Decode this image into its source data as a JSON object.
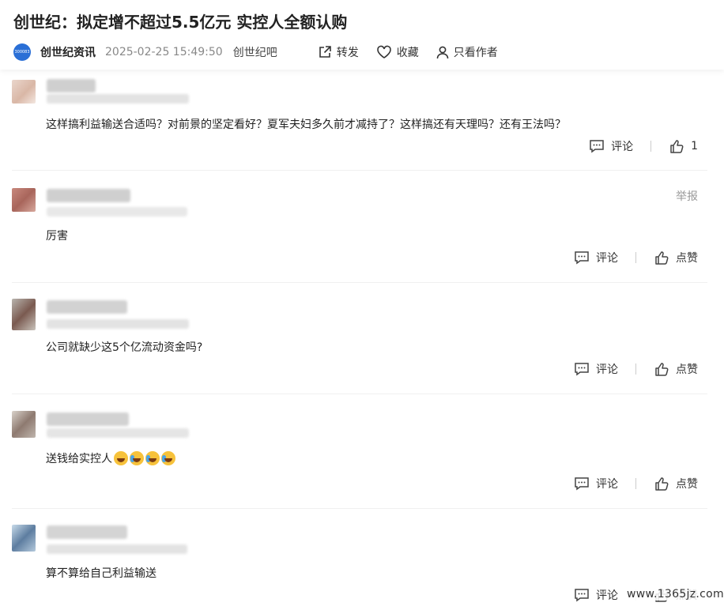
{
  "article": {
    "title": "创世纪：拟定增不超过5.5亿元 实控人全额认购",
    "logo_text": "300083",
    "source": "创世纪资讯",
    "datetime": "2025-02-25 15:49:50",
    "bar": "创世纪吧",
    "actions": {
      "share": "转发",
      "favorite": "收藏",
      "author_only": "只看作者"
    }
  },
  "comments": [
    {
      "text": "这样搞利益输送合适吗？对前景的坚定看好？夏军夫妇多久前才减持了？这样搞还有天理吗？还有王法吗？",
      "reply": "评论",
      "like": "1",
      "report": ""
    },
    {
      "text": "厉害",
      "reply": "评论",
      "like": "点赞",
      "report": "举报"
    },
    {
      "text": "公司就缺少这5个亿流动资金吗?",
      "reply": "评论",
      "like": "点赞",
      "report": ""
    },
    {
      "text": "送钱给实控人",
      "reply": "评论",
      "like": "点赞",
      "report": ""
    },
    {
      "text": "算不算给自己利益输送",
      "reply": "评论",
      "like": "点赞",
      "report": ""
    }
  ],
  "watermark": "www.1365jz.com",
  "colors": {
    "logo": "#2a6fd6",
    "text": "#222222",
    "muted": "#888888"
  }
}
